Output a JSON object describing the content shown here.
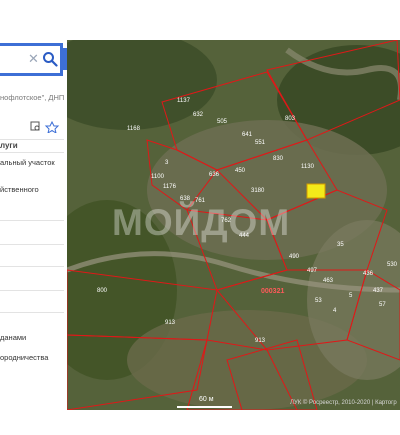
{
  "search": {
    "value": "",
    "clear_icon": "close-icon",
    "search_icon": "search-icon",
    "collapse_label": "‹"
  },
  "panel": {
    "result_subtitle": "нофлотское\", ДНП",
    "services_header": "луги",
    "items": [
      "альный участок",
      "йственного",
      "данами",
      "ородничества"
    ]
  },
  "map": {
    "watermark": "МОЙДОМ",
    "scale_label": "60 м",
    "attribution": "ЛУК © Росреестр, 2010-2020 | Картогр",
    "plot_labels": [
      "1168",
      "1137",
      "632",
      "505",
      "803",
      "1100",
      "3",
      "1176",
      "638",
      "636",
      "830",
      "1130",
      "450",
      "641",
      "551",
      "3180",
      "761",
      "762",
      "444",
      "800",
      "913",
      "913",
      "5",
      "35",
      "490",
      "497",
      "463",
      "436",
      "53",
      "4",
      "57",
      "437",
      "530"
    ],
    "cadastre_label": "000321"
  }
}
